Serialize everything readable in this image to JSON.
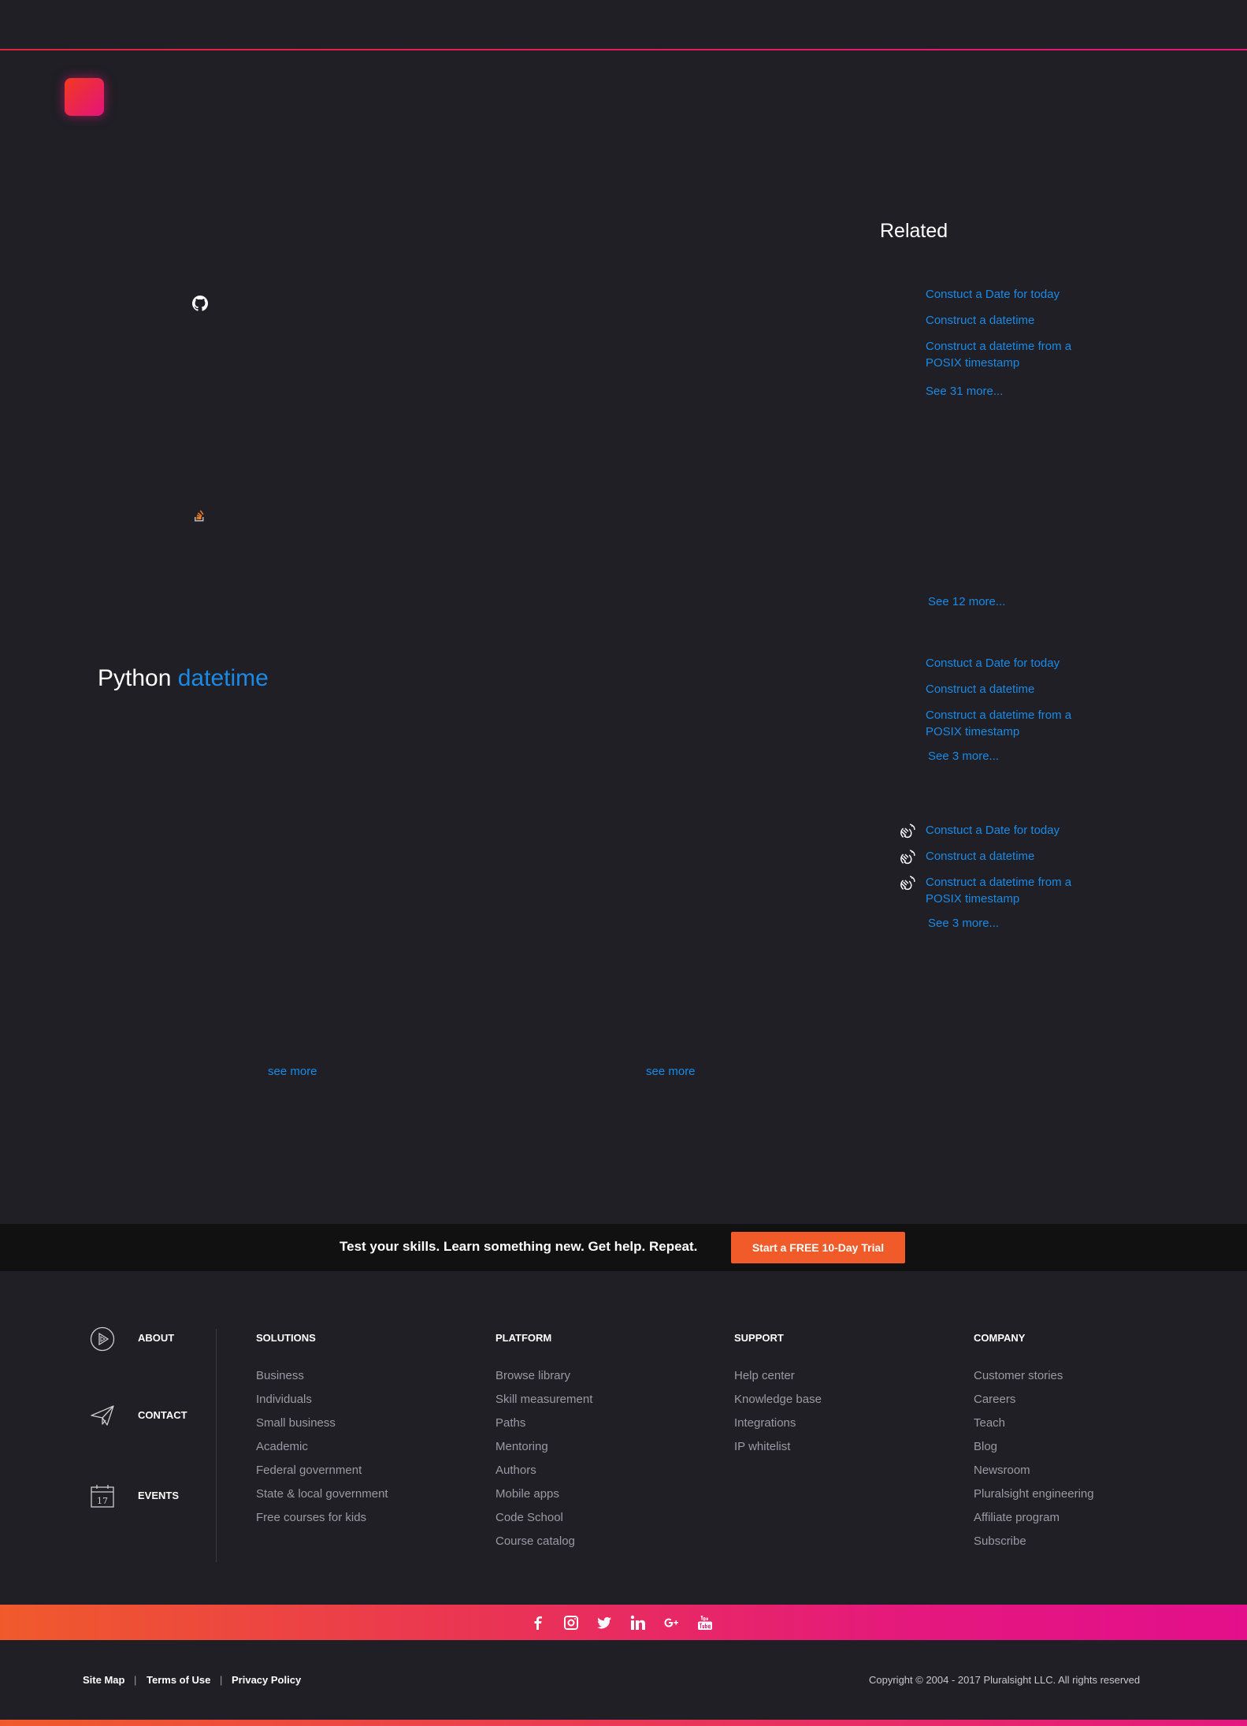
{
  "header": {
    "logo_icon": "pluralsight-logo-icon"
  },
  "sidebar_icons": {
    "github": "github-icon",
    "stackoverflow": "stackoverflow-icon"
  },
  "main": {
    "title_prefix": "Python",
    "title_accent": "datetime",
    "see_more_left": "see more",
    "see_more_right": "see more"
  },
  "related": {
    "title": "Related",
    "group1": [
      "Constuct a Date for today",
      "Construct a datetime",
      "Construct a datetime from a POSIX timestamp"
    ],
    "group1_more": "See 31 more...",
    "group2_more": "See 12 more...",
    "group3": [
      "Constuct a Date for today",
      "Construct a datetime",
      "Construct a datetime from a POSIX timestamp"
    ],
    "group3_more": "See 3 more...",
    "group4": [
      "Constuct a Date for today",
      "Construct a datetime",
      "Construct a datetime from a POSIX timestamp"
    ],
    "group4_more": "See 3 more..."
  },
  "banner": {
    "text": "Test your skills. Learn something new. Get help. Repeat.",
    "cta": "Start a FREE 10-Day Trial",
    "cta_color": "#f15b2a"
  },
  "footer": {
    "side": [
      "ABOUT",
      "CONTACT",
      "EVENTS"
    ],
    "events_day": "17",
    "columns": [
      {
        "head": "SOLUTIONS",
        "items": [
          "Business",
          "Individuals",
          "Small business",
          "Academic",
          "Federal government",
          "State & local government",
          "Free courses for kids"
        ]
      },
      {
        "head": "PLATFORM",
        "items": [
          "Browse library",
          "Skill measurement",
          "Paths",
          "Mentoring",
          "Authors",
          "Mobile apps",
          "Code School",
          "Course catalog"
        ]
      },
      {
        "head": "SUPPORT",
        "items": [
          "Help center",
          "Knowledge base",
          "Integrations",
          "IP whitelist"
        ]
      },
      {
        "head": "COMPANY",
        "items": [
          "Customer stories",
          "Careers",
          "Teach",
          "Blog",
          "Newsroom",
          "Pluralsight engineering",
          "Affiliate program",
          "Subscribe"
        ]
      }
    ],
    "social_icons": [
      "facebook-icon",
      "instagram-icon",
      "twitter-icon",
      "linkedin-icon",
      "google-plus-icon",
      "youtube-icon"
    ],
    "social_glyphs": [
      "f",
      "",
      "",
      "in",
      "G+",
      "You"
    ],
    "legal": [
      "Site Map",
      "Terms of Use",
      "Privacy Policy"
    ],
    "legal_sep": "|",
    "copyright": "Copyright © 2004 - 2017 Pluralsight LLC. All rights reserved"
  },
  "colors": {
    "accent": "#1a8ae6",
    "background": "#1f1f25",
    "brand_orange": "#f05a2b",
    "brand_pink": "#e4177f"
  }
}
